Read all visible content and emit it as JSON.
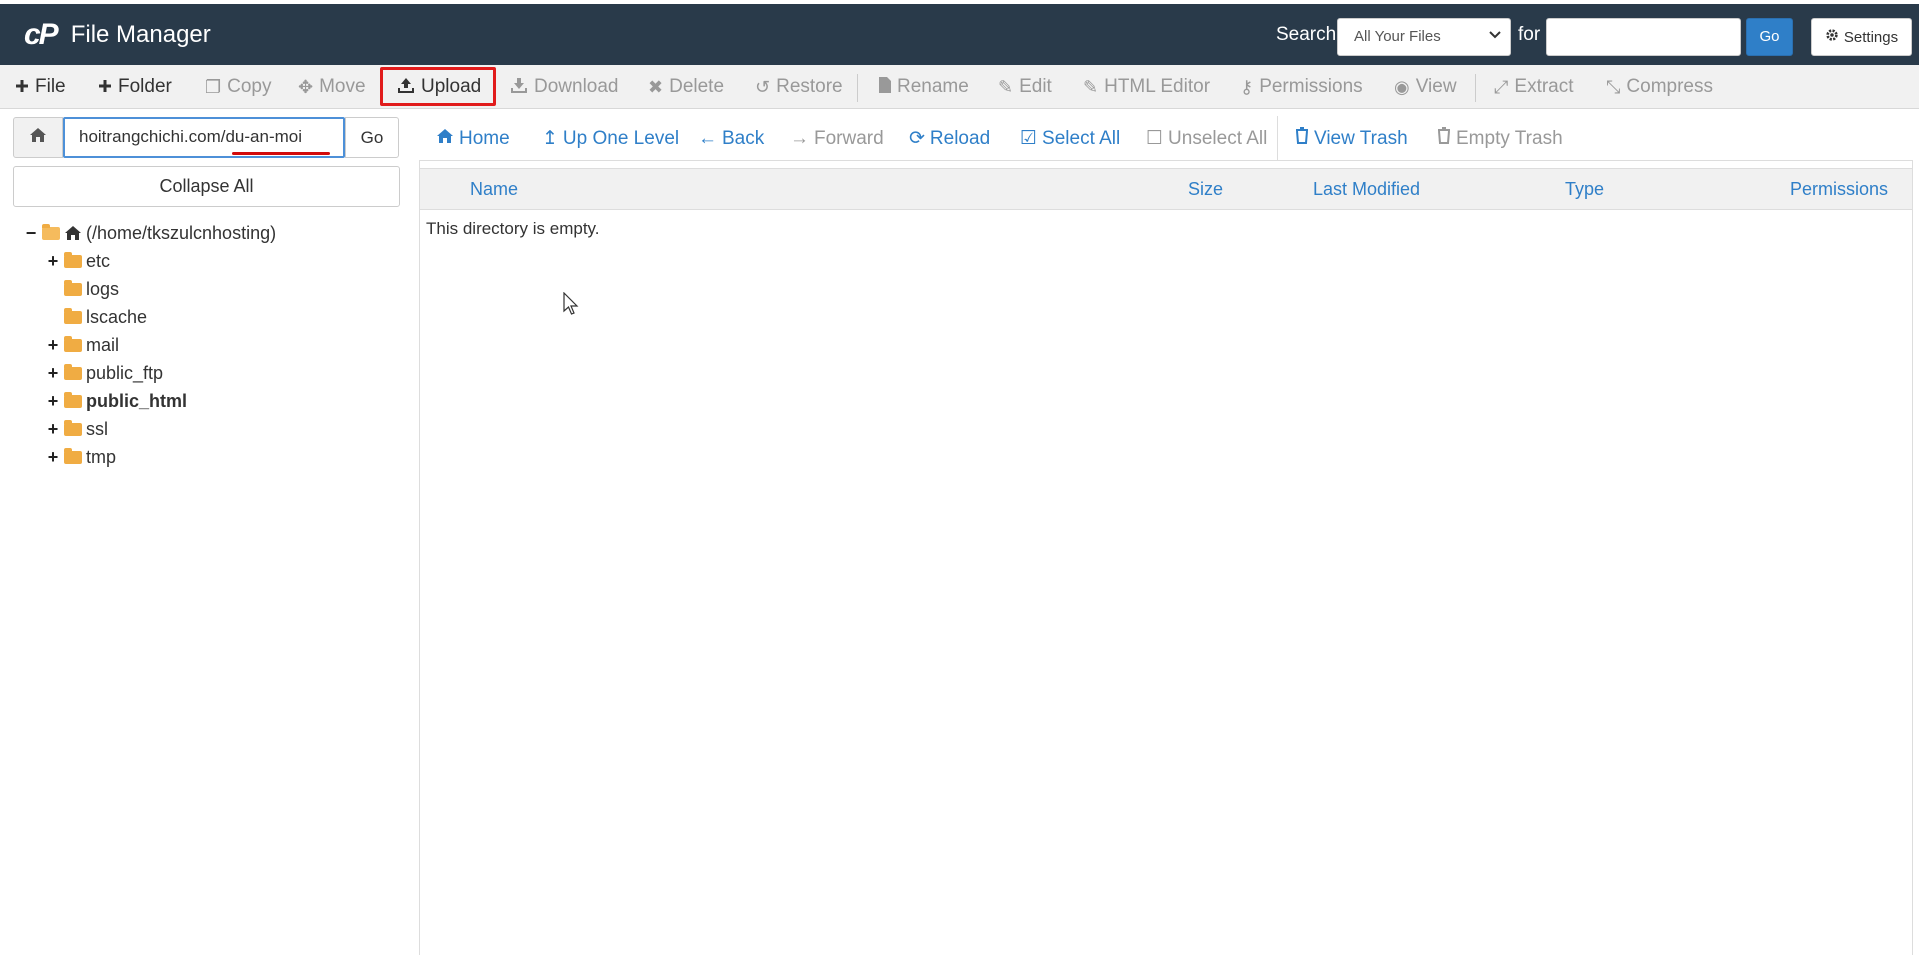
{
  "header": {
    "logo": "cP",
    "title": "File Manager",
    "search_label": "Search",
    "search_scope": "All Your Files",
    "for_label": "for",
    "search_value": "",
    "go_label": "Go",
    "settings_label": "Settings"
  },
  "toolbar": {
    "file": "File",
    "folder": "Folder",
    "copy": "Copy",
    "move": "Move",
    "upload": "Upload",
    "download": "Download",
    "delete": "Delete",
    "restore": "Restore",
    "rename": "Rename",
    "edit": "Edit",
    "html_editor": "HTML Editor",
    "permissions": "Permissions",
    "view": "View",
    "extract": "Extract",
    "compress": "Compress",
    "highlight_color": "#e11b1b"
  },
  "sidebar": {
    "path_value": "hoitrangchichi.com/du-an-moi",
    "go_label": "Go",
    "collapse_label": "Collapse All",
    "root_label": "(/home/tkszulcnhosting)",
    "items": [
      {
        "label": "etc",
        "toggle": "+"
      },
      {
        "label": "logs",
        "toggle": ""
      },
      {
        "label": "lscache",
        "toggle": ""
      },
      {
        "label": "mail",
        "toggle": "+"
      },
      {
        "label": "public_ftp",
        "toggle": "+"
      },
      {
        "label": "public_html",
        "toggle": "+"
      },
      {
        "label": "ssl",
        "toggle": "+"
      },
      {
        "label": "tmp",
        "toggle": "+"
      }
    ]
  },
  "actions": {
    "home": "Home",
    "up": "Up One Level",
    "back": "Back",
    "forward": "Forward",
    "reload": "Reload",
    "select_all": "Select All",
    "unselect_all": "Unselect All",
    "view_trash": "View Trash",
    "empty_trash": "Empty Trash"
  },
  "table": {
    "columns": [
      "Name",
      "Size",
      "Last Modified",
      "Type",
      "Permissions"
    ],
    "empty_message": "This directory is empty."
  },
  "colors": {
    "header_bg": "#293a4a",
    "link_blue": "#2f7fc8",
    "folder": "#f0ac43"
  }
}
